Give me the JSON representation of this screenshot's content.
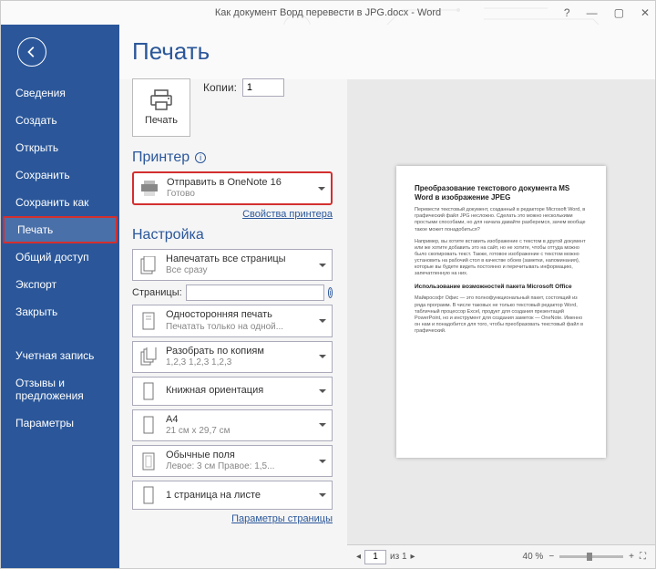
{
  "titlebar": {
    "title": "Как документ Ворд перевести в JPG.docx - Word"
  },
  "sidebar": {
    "items": [
      {
        "label": "Сведения"
      },
      {
        "label": "Создать"
      },
      {
        "label": "Открыть"
      },
      {
        "label": "Сохранить"
      },
      {
        "label": "Сохранить как"
      },
      {
        "label": "Печать"
      },
      {
        "label": "Общий доступ"
      },
      {
        "label": "Экспорт"
      },
      {
        "label": "Закрыть"
      }
    ],
    "items2": [
      {
        "label": "Учетная запись"
      },
      {
        "label": "Отзывы и предложения"
      },
      {
        "label": "Параметры"
      }
    ]
  },
  "print": {
    "heading": "Печать",
    "button": "Печать",
    "copies_label": "Копии:",
    "copies_value": "1"
  },
  "printer": {
    "section": "Принтер",
    "name": "Отправить в OneNote 16",
    "status": "Готово",
    "props_link": "Свойства принтера"
  },
  "setup": {
    "section": "Настройка",
    "dd_pages": {
      "t": "Напечатать все страницы",
      "s": "Все сразу"
    },
    "pages_label": "Страницы:",
    "dd_sides": {
      "t": "Односторонняя печать",
      "s": "Печатать только на одной..."
    },
    "dd_collate": {
      "t": "Разобрать по копиям",
      "s": "1,2,3   1,2,3   1,2,3"
    },
    "dd_orient": {
      "t": "Книжная ориентация",
      "s": ""
    },
    "dd_size": {
      "t": "A4",
      "s": "21 см x 29,7 см"
    },
    "dd_margins": {
      "t": "Обычные поля",
      "s": "Левое: 3 см   Правое: 1,5..."
    },
    "dd_sheet": {
      "t": "1 страница на листе",
      "s": ""
    },
    "page_setup_link": "Параметры страницы"
  },
  "preview": {
    "doc_title": "Преобразование текстового документа MS Word в изображение JPEG",
    "p1": "Перевести текстовый документ, созданный в редакторе Microsoft Word, в графический файл JPG несложно. Сделать это можно несколькими простыми способами, но для начала давайте разберемся, зачем вообще такое может понадобиться?",
    "p2": "Например, вы хотите вставить изображение с текстом в другой документ или же хотите добавить это на сайт, но не хотите, чтобы оттуда можно было скопировать текст. Также, готовое изображение с текстом можно установить на рабочий стол в качестве обоев (заметки, напоминания), которые вы будете видеть постоянно и перечитывать информацию, запечатленную на них.",
    "h2": "Использование возможностей пакета Microsoft Office",
    "p3": "Майкрософт Офис — это полнофункциональный пакет, состоящий из ряда программ. В числе таковых не только текстовый редактор Word, табличный процессор Excel, продукт для создания презентаций PowerPoint, но и инструмент для создания заметок — OneNote. Именно он нам и понадобится для того, чтобы преобразовать текстовый файл в графический.",
    "page_current": "1",
    "page_of": "из 1",
    "zoom": "40 %"
  }
}
